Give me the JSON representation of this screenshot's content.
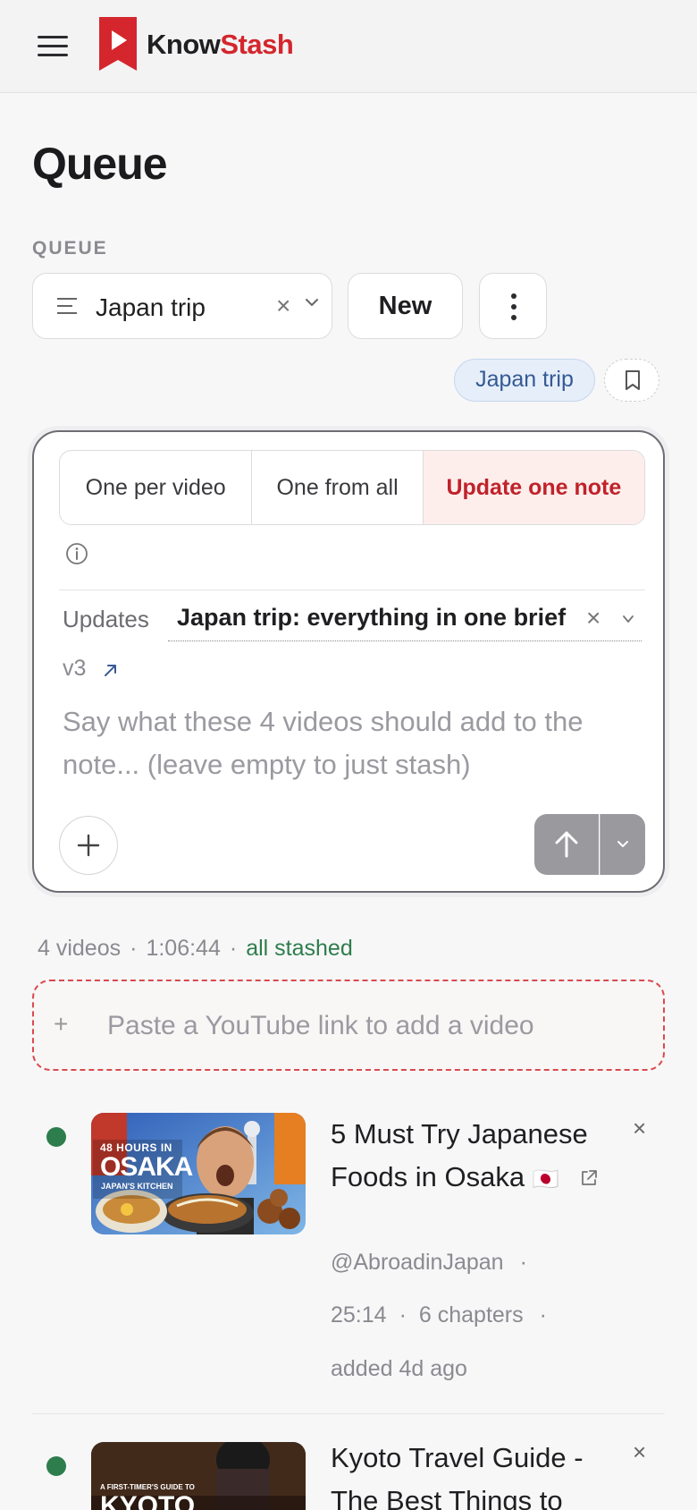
{
  "brand": {
    "name_part1": "Know",
    "name_part2": "Stash"
  },
  "page": {
    "title": "Queue",
    "section_label": "QUEUE"
  },
  "queue_select": {
    "value": "Japan trip",
    "clear_glyph": "×"
  },
  "actions": {
    "new_label": "New"
  },
  "tags": [
    {
      "label": "Japan trip"
    }
  ],
  "composer": {
    "modes": [
      {
        "label": "One per video",
        "selected": false
      },
      {
        "label": "One from all",
        "selected": false
      },
      {
        "label": "Update one note",
        "selected": true
      }
    ],
    "updates_label": "Updates",
    "target_note": "Japan trip: everything in one brief",
    "clear_glyph": "×",
    "version": "v3",
    "prompt_placeholder": "Say what these 4 videos should add to the note... (leave empty to just stash)"
  },
  "stats": {
    "count": "4 videos",
    "duration": "1:06:44",
    "status": "all stashed",
    "separator": "·"
  },
  "paste": {
    "plus": "+",
    "placeholder": "Paste a YouTube link to add a video"
  },
  "videos": [
    {
      "title": "5 Must Try Japanese Foods in Osaka",
      "flag": "🇯🇵",
      "channel": "@AbroadinJapan",
      "duration": "25:14",
      "chapters": "6 chapters",
      "added": "added 4d ago",
      "thumb_caption_top": "48 HOURS IN",
      "thumb_caption_main": "OSAKA",
      "thumb_caption_sub": "JAPAN'S KITCHEN",
      "close_glyph": "×"
    },
    {
      "title": "Kyoto Travel Guide - The Best Things to",
      "thumb_caption_top": "A FIRST-TIMER'S GUIDE TO",
      "thumb_caption_main": "KYOTO",
      "close_glyph": "×"
    }
  ],
  "colors": {
    "accent": "#d4262c",
    "status_green": "#2e7d4c",
    "chip_blue": "#345a94"
  }
}
